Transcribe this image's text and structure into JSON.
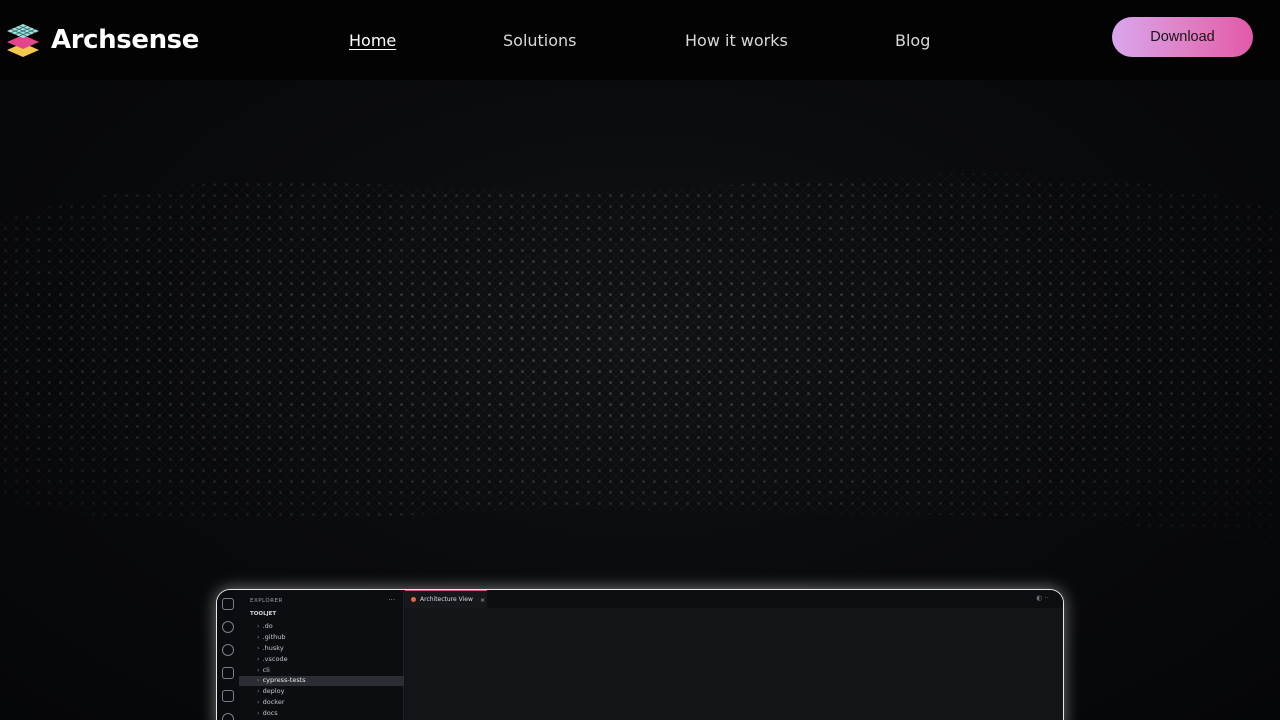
{
  "brand": {
    "name": "Archsense",
    "logo_icon": "stacked-layers-logo"
  },
  "nav": {
    "links": [
      {
        "label": "Home",
        "active": true
      },
      {
        "label": "Solutions",
        "active": false
      },
      {
        "label": "How it works",
        "active": false
      },
      {
        "label": "Blog",
        "active": false
      }
    ],
    "download_label": "Download"
  },
  "colors": {
    "download_gradient_start": "#d9a6ee",
    "download_gradient_end": "#e35aa8",
    "background": "#050607",
    "frame_border": "#e9e9e9",
    "tab_accent": "#d0567e"
  },
  "ide": {
    "explorer_title": "EXPLORER",
    "explorer_more": "···",
    "root_folder": "TOOLJET",
    "tree": [
      {
        "label": ".do",
        "selected": false
      },
      {
        "label": ".github",
        "selected": false
      },
      {
        "label": ".husky",
        "selected": false
      },
      {
        "label": ".vscode",
        "selected": false
      },
      {
        "label": "cli",
        "selected": false
      },
      {
        "label": "cypress-tests",
        "selected": true
      },
      {
        "label": "deploy",
        "selected": false
      },
      {
        "label": "docker",
        "selected": false
      },
      {
        "label": "docs",
        "selected": false
      }
    ],
    "tab_label": "Architecture View",
    "tab_close": "×",
    "activity_icons": [
      "files-icon",
      "search-icon",
      "source-control-icon",
      "run-debug-icon",
      "extensions-icon",
      "account-icon"
    ]
  }
}
